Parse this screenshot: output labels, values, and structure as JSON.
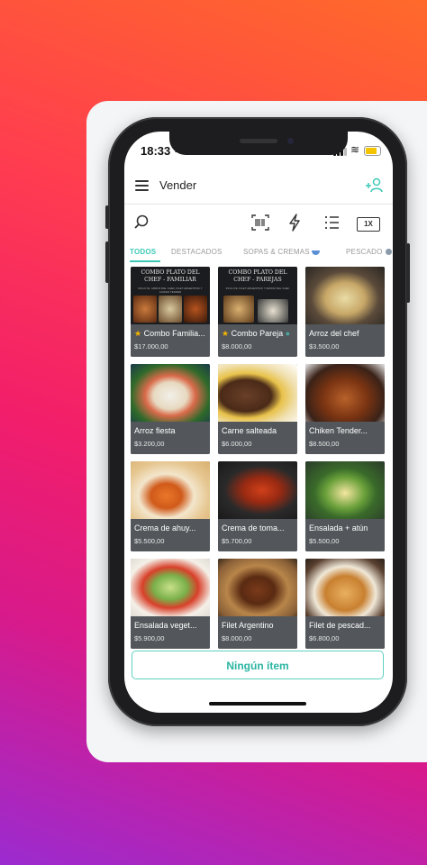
{
  "status_bar": {
    "time": "18:33"
  },
  "app_bar": {
    "title": "Vender"
  },
  "toolbar": {
    "qty_label": "1X"
  },
  "tabs": [
    {
      "label": "TODOS",
      "active": true
    },
    {
      "label": "DESTACADOS",
      "active": false
    },
    {
      "label": "SOPAS & CREMAS",
      "active": false,
      "icon": "bowl-icon"
    },
    {
      "label": "PESCADO",
      "active": false,
      "icon": "fish-icon"
    }
  ],
  "posters": [
    {
      "title": "COMBO PLATO DEL CHEF - FAMILIAR",
      "subtitle": "INCLUYE: ARROZ DEL CHEF, FILET ARGENTINO Y CHIKEN TENDER"
    },
    {
      "title": "COMBO PLATO DEL CHEF - PAREJAS",
      "subtitle": "INCLUYE: FILET ARGENTINO Y ARROZ DEL CHEF"
    }
  ],
  "products": [
    {
      "name": "Combo Familia...",
      "price": "$17.000,00",
      "featured": true
    },
    {
      "name": "Combo Pareja",
      "price": "$8.000,00",
      "featured": true
    },
    {
      "name": "Arroz del chef",
      "price": "$3.500,00",
      "featured": false
    },
    {
      "name": "Arroz fiesta",
      "price": "$3.200,00",
      "featured": false
    },
    {
      "name": "Carne salteada",
      "price": "$6.000,00",
      "featured": false
    },
    {
      "name": "Chiken Tender...",
      "price": "$8.500,00",
      "featured": false
    },
    {
      "name": "Crema de ahuy...",
      "price": "$5.500,00",
      "featured": false
    },
    {
      "name": "Crema de toma...",
      "price": "$5.700,00",
      "featured": false
    },
    {
      "name": "Ensalada + atún",
      "price": "$5.500,00",
      "featured": false
    },
    {
      "name": "Ensalada veget...",
      "price": "$5.900,00",
      "featured": false
    },
    {
      "name": "Filet Argentino",
      "price": "$8.000,00",
      "featured": false
    },
    {
      "name": "Filet de pescad...",
      "price": "$6.800,00",
      "featured": false
    }
  ],
  "cart_button": {
    "label": "Ningún ítem"
  },
  "colors": {
    "accent": "#3ec9b7",
    "caption_bg": "#53575b",
    "star": "#f5b400"
  }
}
